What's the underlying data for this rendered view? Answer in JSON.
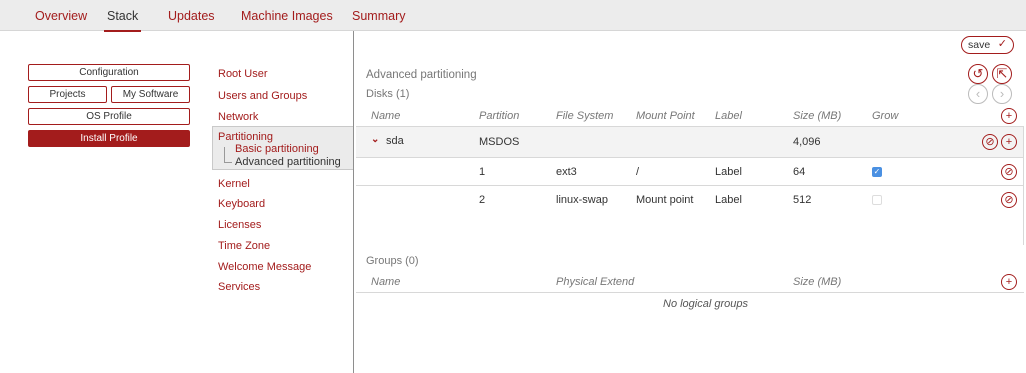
{
  "tabs": [
    "Overview",
    "Stack",
    "Updates",
    "Machine Images",
    "Summary"
  ],
  "active_tab": "Stack",
  "left_buttons": {
    "configuration": "Configuration",
    "projects": "Projects",
    "my_software": "My Software",
    "os_profile": "OS Profile",
    "install_profile": "Install Profile"
  },
  "nav": {
    "root_user": "Root User",
    "users_groups": "Users and Groups",
    "network": "Network",
    "partitioning": "Partitioning",
    "basic_partitioning": "Basic partitioning",
    "advanced_partitioning": "Advanced partitioning",
    "kernel": "Kernel",
    "keyboard": "Keyboard",
    "licenses": "Licenses",
    "time_zone": "Time Zone",
    "welcome_message": "Welcome Message",
    "services": "Services"
  },
  "main": {
    "save_label": "save",
    "heading": "Advanced partitioning",
    "disks_label": "Disks (1)",
    "disk_columns": [
      "Name",
      "Partition",
      "File System",
      "Mount Point",
      "Label",
      "Size (MB)",
      "Grow"
    ],
    "disk": {
      "name": "sda",
      "partition": "MSDOS",
      "size": "4,096"
    },
    "partitions": [
      {
        "partition": "1",
        "fs": "ext3",
        "mount": "/",
        "label": "Label",
        "size": "64",
        "grow": true
      },
      {
        "partition": "2",
        "fs": "linux-swap",
        "mount": "Mount point",
        "label": "Label",
        "size": "512",
        "grow": false
      }
    ],
    "groups_label": "Groups (0)",
    "group_columns": [
      "Name",
      "Physical Extend",
      "Size (MB)"
    ],
    "no_groups": "No logical groups"
  },
  "colors": {
    "accent": "#a31c1c",
    "checkbox": "#4a90e2"
  },
  "icons": [
    "save-check-icon",
    "undo-icon",
    "export-icon",
    "prev-icon",
    "next-icon",
    "add-icon",
    "remove-icon",
    "expand-chevron-icon"
  ]
}
